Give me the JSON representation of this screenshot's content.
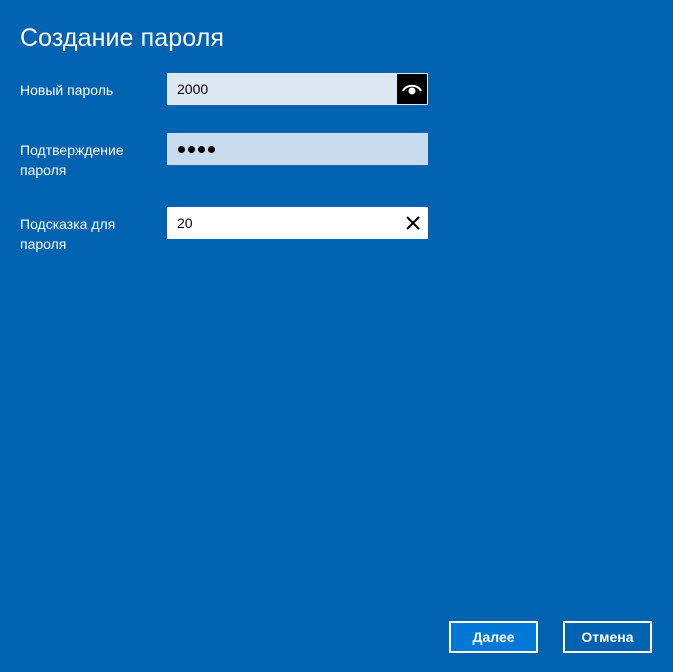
{
  "title": "Создание пароля",
  "colors": {
    "background": "#0063b1",
    "accent_button": "#0078d7",
    "text": "#ffffff"
  },
  "fields": {
    "new_password": {
      "label": "Новый пароль",
      "value": "2000",
      "icon": "eye-icon"
    },
    "confirm_password": {
      "label_line1": "Подтверждение",
      "label_line2": "пароля",
      "masked_length": 4
    },
    "hint": {
      "label_line1": "Подсказка для",
      "label_line2": "пароля",
      "value": "20",
      "icon": "close-icon"
    }
  },
  "buttons": {
    "next": "Далее",
    "cancel": "Отмена"
  }
}
